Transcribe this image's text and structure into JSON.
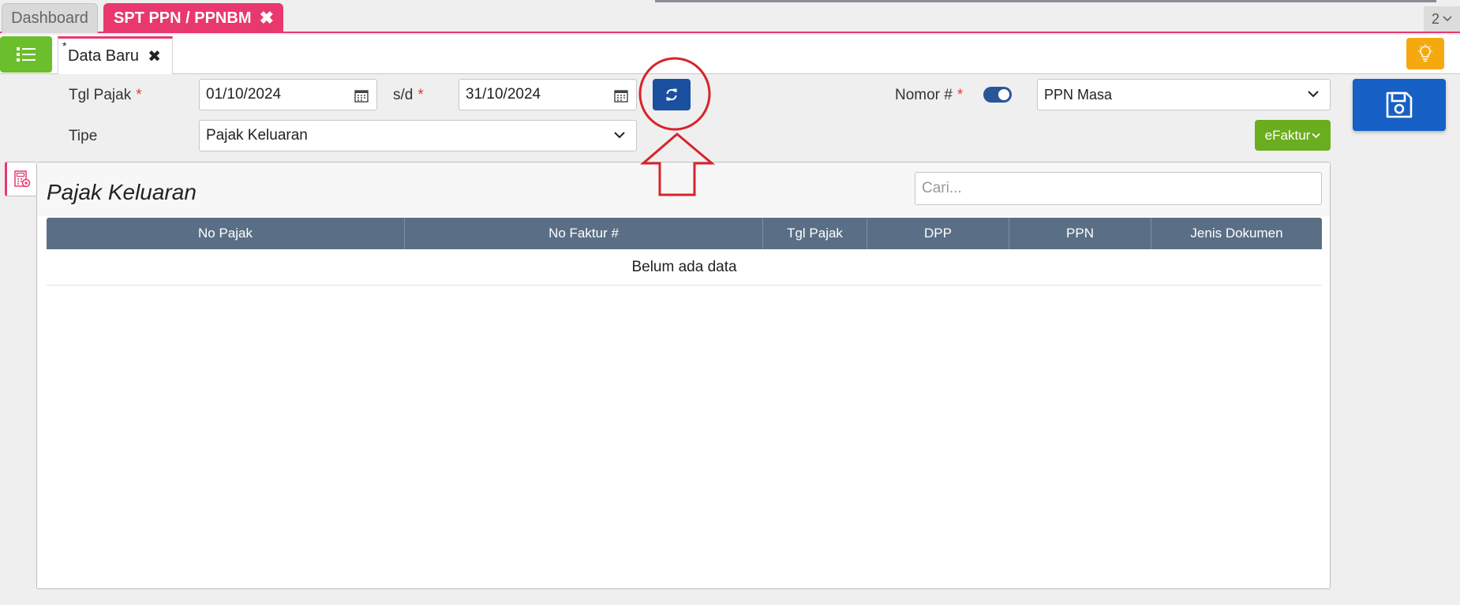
{
  "tabs": {
    "dashboard": "Dashboard",
    "active": "SPT PPN / PPNBM",
    "close": "✖",
    "count": "2"
  },
  "document_tab": {
    "modified_marker": "*",
    "label": "Data Baru",
    "close": "✖"
  },
  "form": {
    "tgl_pajak_label": "Tgl Pajak",
    "required_marker": "*",
    "date_from": "01/10/2024",
    "sd_label": "s/d",
    "date_to": "31/10/2024",
    "nomor_label": "Nomor #",
    "nomor_select": "PPN Masa",
    "tipe_label": "Tipe",
    "tipe_select": "Pajak Keluaran",
    "efaktur_label": "eFaktur"
  },
  "panel": {
    "title": "Pajak Keluaran",
    "search_placeholder": "Cari...",
    "columns": [
      "No Pajak",
      "No Faktur #",
      "Tgl Pajak",
      "DPP",
      "PPN",
      "Jenis Dokumen"
    ],
    "empty_text": "Belum ada data"
  },
  "colors": {
    "accent_pink": "#e8386d",
    "menu_green": "#6cbf2c",
    "refresh_blue": "#1b4f9f",
    "save_blue": "#1760c5",
    "table_header": "#5a6f86",
    "annotation_red": "#d8232a"
  },
  "icons": {
    "menu": "list-icon",
    "bulb": "lightbulb-icon",
    "calendar": "calendar-icon",
    "refresh": "refresh-icon",
    "save": "floppy-disk-icon",
    "side_tab": "calculator-document-icon"
  }
}
